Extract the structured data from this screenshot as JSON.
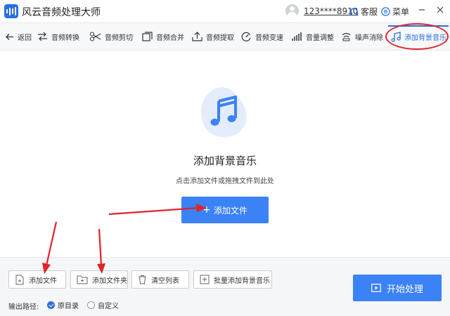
{
  "app": {
    "title": "风云音频处理大师",
    "user_id": "123****8910",
    "service_label": "客服",
    "menu_label": "菜单"
  },
  "toolbar": {
    "items": [
      {
        "label": "返回",
        "icon": "arrow-left-icon"
      },
      {
        "label": "音频转换",
        "icon": "swap-icon"
      },
      {
        "label": "音频剪切",
        "icon": "scissors-icon"
      },
      {
        "label": "音频合并",
        "icon": "merge-icon"
      },
      {
        "label": "音频提取",
        "icon": "upload-icon"
      },
      {
        "label": "音频变速",
        "icon": "speed-icon"
      },
      {
        "label": "音量调整",
        "icon": "volume-bars-icon"
      },
      {
        "label": "噪声消除",
        "icon": "noise-icon"
      },
      {
        "label": "添加背景音乐",
        "icon": "music-note-icon"
      }
    ],
    "active_index": 8
  },
  "main": {
    "headline": "添加背景音乐",
    "hint": "点击添加文件或拖拽文件到此处",
    "add_file_label": "添加文件"
  },
  "bottom": {
    "buttons": [
      "添加文件",
      "添加文件夹",
      "清空列表",
      "批量添加背景音乐"
    ],
    "output_path_label": "输出路径:",
    "radio_original": "原目录",
    "radio_custom": "自定义",
    "selected_radio": "原目录",
    "start_label": "开始处理"
  },
  "colors": {
    "accent": "#3b82f6",
    "accent_dark": "#2b6fe0",
    "annotation": "#e0242b"
  }
}
